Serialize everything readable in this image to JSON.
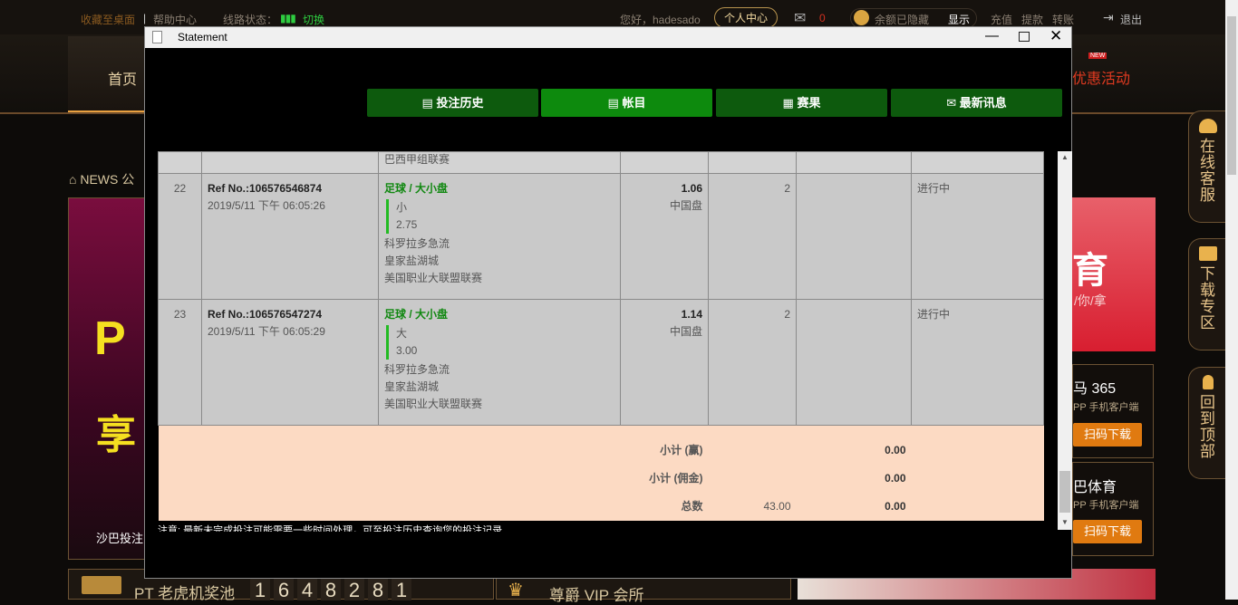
{
  "topbar": {
    "bookmark": "收藏至桌面",
    "help": "帮助中心",
    "line_status": "线路状态：",
    "switch": "切换",
    "greeting": "您好，hadesado",
    "personal_center": "个人中心",
    "messages": "0",
    "balance_hidden": "余额已隐藏",
    "show": "显示",
    "deposit": "充值",
    "withdraw": "提款",
    "transfer": "转账",
    "logout": "退出"
  },
  "nav": {
    "home": "首页",
    "promo": "优惠活动",
    "new_badge": "NEW"
  },
  "left": {
    "news": "NEWS 公",
    "banner_caption": "沙巴投注"
  },
  "right_promos": [
    {
      "title": "马 365",
      "sub": "PP 手机客户端",
      "btn": "扫码下载"
    },
    {
      "title": "巴体育",
      "sub": "PP 手机客户端",
      "btn": "扫码下载"
    }
  ],
  "banner_text": "育",
  "banner_sub": "/你/拿",
  "side_buttons": [
    {
      "label": "在线客服",
      "icon": "headset-icon"
    },
    {
      "label": "下载专区",
      "icon": "monitor-icon"
    },
    {
      "label": "回到顶部",
      "icon": "rocket-icon"
    }
  ],
  "bottom": {
    "jackpot_label": "PT 老虎机奖池",
    "jackpot_digits": [
      "1",
      "6",
      "4",
      "8",
      "2",
      "8",
      "1"
    ],
    "vip": "尊爵 VIP 会所"
  },
  "modal": {
    "title": "Statement",
    "tabs": [
      {
        "label": "投注历史",
        "icon": "clipboard-icon"
      },
      {
        "label": "帐目",
        "icon": "ledger-icon",
        "active": true
      },
      {
        "label": "赛果",
        "icon": "results-icon"
      },
      {
        "label": "最新讯息",
        "icon": "mail-icon"
      }
    ],
    "partial_row": {
      "league": "巴西甲组联赛"
    },
    "rows": [
      {
        "no": "22",
        "ref": "Ref No.:106576546874",
        "time": "2019/5/11 下午 06:05:26",
        "sport": "足球 / 大小盘",
        "pick": "小",
        "line": "2.75",
        "home": "科罗拉多急流",
        "away": "皇家盐湖城",
        "league": "美国职业大联盟联赛",
        "odds": "1.06",
        "odds_type": "中国盘",
        "stake": "2",
        "winloss": "",
        "status": "进行中"
      },
      {
        "no": "23",
        "ref": "Ref No.:106576547274",
        "time": "2019/5/11 下午 06:05:29",
        "sport": "足球 / 大小盘",
        "pick": "大",
        "line": "3.00",
        "home": "科罗拉多急流",
        "away": "皇家盐湖城",
        "league": "美国职业大联盟联赛",
        "odds": "1.14",
        "odds_type": "中国盘",
        "stake": "2",
        "winloss": "",
        "status": "进行中"
      }
    ],
    "totals": [
      {
        "label": "小计 (赢)",
        "stake": "",
        "value": "0.00"
      },
      {
        "label": "小计 (佣金)",
        "stake": "",
        "value": "0.00"
      },
      {
        "label": "总数",
        "stake": "43.00",
        "value": "0.00"
      }
    ],
    "note": "注意: 最新未完成投注可能需要一些时间处理，可至投注历史查询您的投注记录"
  }
}
